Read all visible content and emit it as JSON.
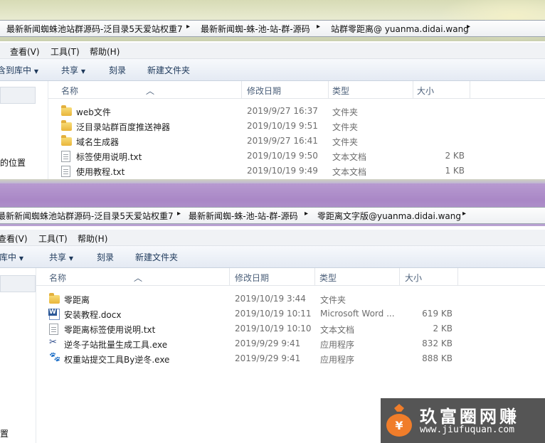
{
  "window1": {
    "breadcrumb": [
      "最新新闻蜘蛛池站群源码-泛目录5天爱站权重7",
      "最新新闻蜘-蛛-池-站-群-源码",
      "站群零距离@ yuanma.didai.wang"
    ],
    "menu": [
      "查看(V)",
      "工具(T)",
      "帮助(H)"
    ],
    "toolbar": {
      "include": "含到库中",
      "share": "共享",
      "burn": "刻录",
      "new_folder": "新建文件夹"
    },
    "nav": {
      "item": "的位置"
    },
    "columns": {
      "name": "名称",
      "date": "修改日期",
      "type": "类型",
      "size": "大小"
    },
    "files": [
      {
        "name": "web文件",
        "date": "2019/9/27 16:37",
        "type": "文件夹",
        "size": "",
        "icon": "folder-icon"
      },
      {
        "name": "泛目录站群百度推送神器",
        "date": "2019/10/19 9:51",
        "type": "文件夹",
        "size": "",
        "icon": "folder-icon"
      },
      {
        "name": "域名生成器",
        "date": "2019/9/27 16:41",
        "type": "文件夹",
        "size": "",
        "icon": "folder-icon"
      },
      {
        "name": "标签使用说明.txt",
        "date": "2019/10/19 9:50",
        "type": "文本文档",
        "size": "2 KB",
        "icon": "text-file-icon"
      },
      {
        "name": "使用教程.txt",
        "date": "2019/10/19 9:49",
        "type": "文本文档",
        "size": "1 KB",
        "icon": "text-file-icon"
      }
    ]
  },
  "window2": {
    "breadcrumb": [
      "最新新闻蜘蛛池站群源码-泛目录5天爱站权重7",
      "最新新闻蜘-蛛-池-站-群-源码",
      "零距离文字版@yuanma.didai.wang"
    ],
    "menu": [
      "查看(V)",
      "工具(T)",
      "帮助(H)"
    ],
    "toolbar": {
      "include": "库中",
      "share": "共享",
      "burn": "刻录",
      "new_folder": "新建文件夹"
    },
    "nav": {
      "item": "置"
    },
    "columns": {
      "name": "名称",
      "date": "修改日期",
      "type": "类型",
      "size": "大小"
    },
    "files": [
      {
        "name": "零距离",
        "date": "2019/10/19 3:44",
        "type": "文件夹",
        "size": "",
        "icon": "folder-icon"
      },
      {
        "name": "安装教程.docx",
        "date": "2019/10/19 10:11",
        "type": "Microsoft Word ...",
        "size": "619 KB",
        "icon": "word-doc-icon"
      },
      {
        "name": "零距离标签使用说明.txt",
        "date": "2019/10/19 10:10",
        "type": "文本文档",
        "size": "2 KB",
        "icon": "text-file-icon"
      },
      {
        "name": "逆冬子站批量生成工具.exe",
        "date": "2019/9/29 9:41",
        "type": "应用程序",
        "size": "832 KB",
        "icon": "tool-exe-icon"
      },
      {
        "name": "权重站提交工具By逆冬.exe",
        "date": "2019/9/29 9:41",
        "type": "应用程序",
        "size": "888 KB",
        "icon": "paw-exe-icon"
      }
    ]
  },
  "watermark": {
    "brand": "玖富圈网赚",
    "url": "www.jiufuquan.com"
  },
  "glyphs": {
    "sep": "▸",
    "dropdown": "▼",
    "sort": "︿",
    "tool": "✂",
    "paw": "🐾"
  },
  "colors": {
    "window1_frame": "#d7dbb5",
    "window2_frame": "#a987c6",
    "toolbar_text": "#1e395b",
    "watermark_bg": "#464646",
    "logo_orange": "#f07d2a"
  }
}
